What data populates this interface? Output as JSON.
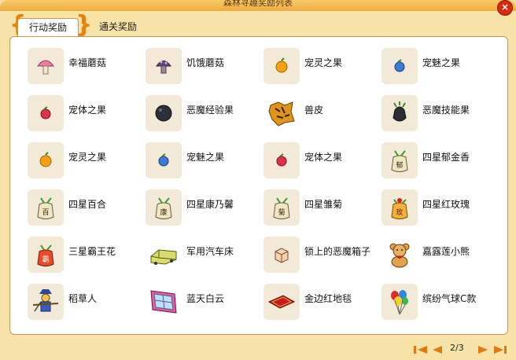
{
  "window": {
    "title": "森林寻趣奖励列表",
    "close_label": "×"
  },
  "tabs": [
    {
      "label": "行动奖励",
      "active": true
    },
    {
      "label": "通关奖励",
      "active": false
    }
  ],
  "items": [
    {
      "label": "幸福蘑菇",
      "icon": "pink-mushroom-icon"
    },
    {
      "label": "饥饿蘑菇",
      "icon": "purple-mushroom-icon"
    },
    {
      "label": "宠灵之果",
      "icon": "orange-fruit-icon"
    },
    {
      "label": "宠魅之果",
      "icon": "blue-fruit-icon"
    },
    {
      "label": "宠体之果",
      "icon": "red-fruit-icon"
    },
    {
      "label": "恶魔经验果",
      "icon": "dark-orb-icon"
    },
    {
      "label": "兽皮",
      "icon": "tiger-pelt-icon"
    },
    {
      "label": "恶魔技能果",
      "icon": "dark-bulb-icon"
    },
    {
      "label": "宠灵之果",
      "icon": "orange-fruit-icon"
    },
    {
      "label": "宠魅之果",
      "icon": "blue-fruit-icon"
    },
    {
      "label": "宠体之果",
      "icon": "red-fruit-icon"
    },
    {
      "label": "四星郁金香",
      "icon": "seed-bag-icon",
      "bag_text": "郁"
    },
    {
      "label": "四星百合",
      "icon": "seed-bag-icon",
      "bag_text": "百"
    },
    {
      "label": "四星康乃馨",
      "icon": "seed-bag-icon",
      "bag_text": "康"
    },
    {
      "label": "四星雏菊",
      "icon": "seed-bag-icon",
      "bag_text": "菊"
    },
    {
      "label": "四星红玫瑰",
      "icon": "seed-bag-orange-icon",
      "bag_text": "玫"
    },
    {
      "label": "三星霸王花",
      "icon": "seed-bag-red-icon",
      "bag_text": "霸"
    },
    {
      "label": "军用汽车床",
      "icon": "car-bed-icon"
    },
    {
      "label": "锁上的恶魔箱子",
      "icon": "locked-box-icon"
    },
    {
      "label": "嘉露莲小熊",
      "icon": "teddy-bear-icon"
    },
    {
      "label": "稻草人",
      "icon": "scarecrow-icon"
    },
    {
      "label": "蓝天白云",
      "icon": "window-picture-icon"
    },
    {
      "label": "金边红地毯",
      "icon": "red-carpet-icon"
    },
    {
      "label": "缤纷气球C款",
      "icon": "balloons-icon"
    }
  ],
  "pagination": {
    "text": "2/3"
  }
}
